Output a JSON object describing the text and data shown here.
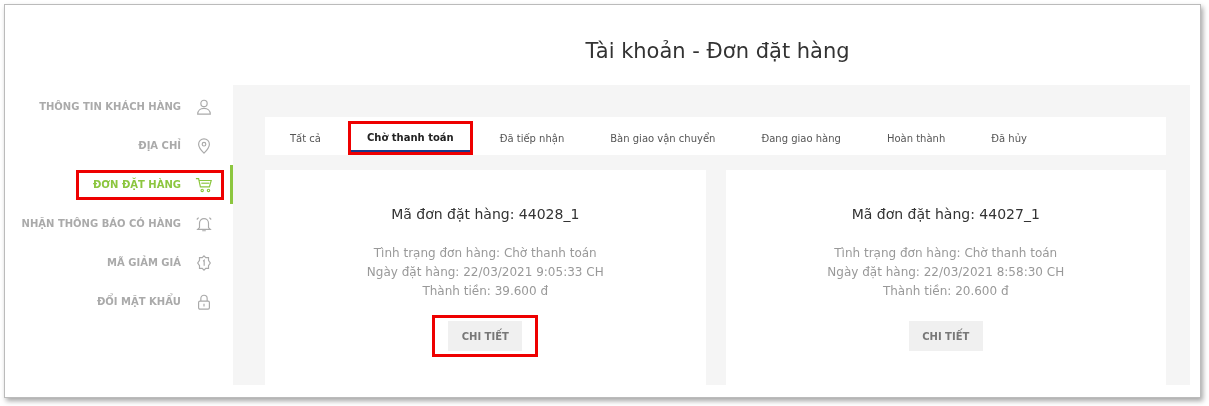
{
  "title": "Tài khoản - Đơn đặt hàng",
  "sidebar": {
    "items": [
      {
        "label": "THÔNG TIN KHÁCH HÀNG",
        "selected": false,
        "highlighted": false
      },
      {
        "label": "ĐỊA CHỈ",
        "selected": false,
        "highlighted": false
      },
      {
        "label": "ĐƠN ĐẶT HÀNG",
        "selected": true,
        "highlighted": true
      },
      {
        "label": "NHẬN THÔNG BÁO CÓ HÀNG",
        "selected": false,
        "highlighted": false
      },
      {
        "label": "MÃ GIẢM GIÁ",
        "selected": false,
        "highlighted": false
      },
      {
        "label": "ĐỔI MẬT KHẨU",
        "selected": false,
        "highlighted": false
      }
    ]
  },
  "tabs": [
    {
      "label": "Tất cả",
      "selected": false,
      "highlighted": false
    },
    {
      "label": "Chờ thanh toán",
      "selected": true,
      "highlighted": true
    },
    {
      "label": "Đã tiếp nhận",
      "selected": false,
      "highlighted": false
    },
    {
      "label": "Bàn giao vận chuyển",
      "selected": false,
      "highlighted": false
    },
    {
      "label": "Đang giao hàng",
      "selected": false,
      "highlighted": false
    },
    {
      "label": "Hoàn thành",
      "selected": false,
      "highlighted": false
    },
    {
      "label": "Đã hủy",
      "selected": false,
      "highlighted": false
    }
  ],
  "orders": [
    {
      "title": "Mã đơn đặt hàng: 44028_1",
      "status": "Tình trạng đơn hàng: Chờ thanh toán",
      "date": "Ngày đặt hàng: 22/03/2021 9:05:33 CH",
      "total": "Thành tiền: 39.600 đ",
      "button": {
        "label": "CHI TIẾT",
        "highlighted": true
      }
    },
    {
      "title": "Mã đơn đặt hàng: 44027_1",
      "status": "Tình trạng đơn hàng: Chờ thanh toán",
      "date": "Ngày đặt hàng: 22/03/2021 8:58:30 CH",
      "total": "Thành tiền: 20.600 đ",
      "button": {
        "label": "CHI TIẾT",
        "highlighted": false
      }
    }
  ]
}
